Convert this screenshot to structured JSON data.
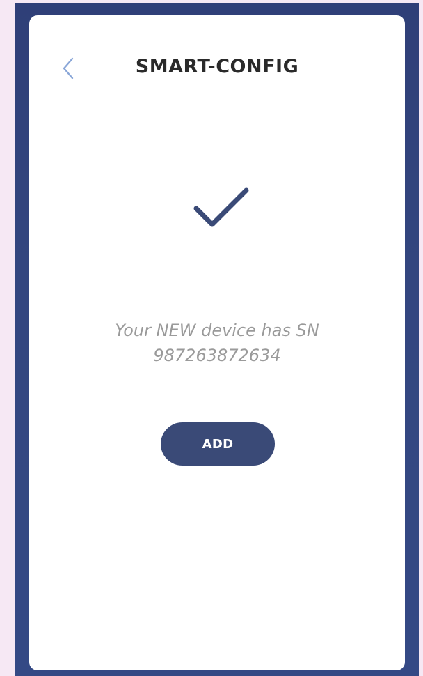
{
  "header": {
    "title": "SMART-CONFIG",
    "back_icon": "chevron-left-icon"
  },
  "status": {
    "icon": "checkmark-icon",
    "message_line1": "Your NEW device has SN",
    "message_line2": "987263872634"
  },
  "actions": {
    "add_label": "ADD"
  },
  "colors": {
    "frame": "#33467f",
    "card": "#ffffff",
    "accent": "#3a4a77",
    "back_icon": "#8aa7d8",
    "message_text": "#9a9a9a",
    "title_text": "#2a2a2a"
  }
}
